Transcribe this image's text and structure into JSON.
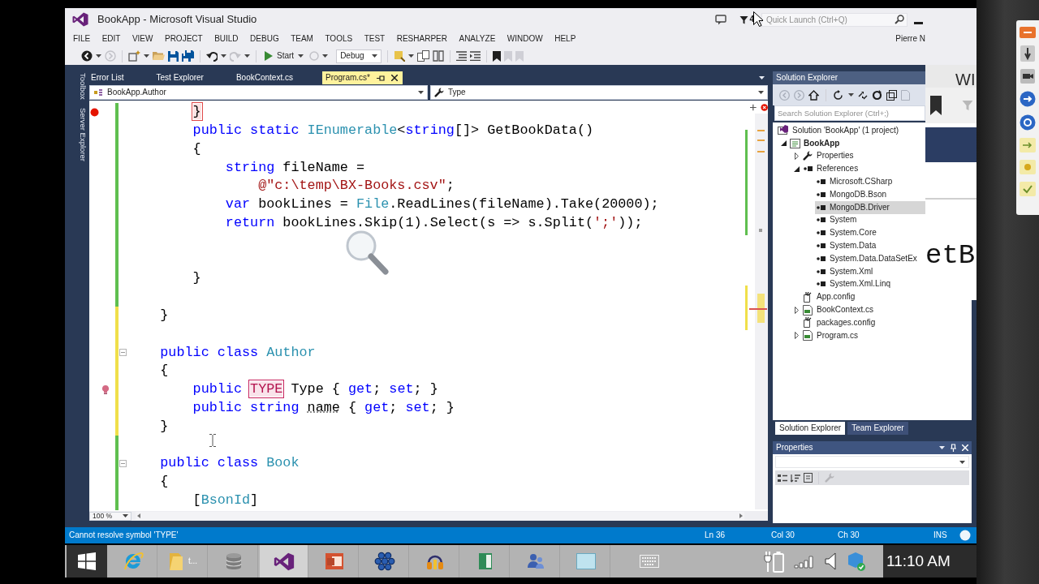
{
  "window": {
    "title": "BookApp - Microsoft Visual Studio",
    "notifications": "4",
    "quick_launch": {
      "placeholder": "Quick Launch (Ctrl+Q)"
    },
    "user": "Pierre N"
  },
  "menu": [
    "FILE",
    "EDIT",
    "VIEW",
    "PROJECT",
    "BUILD",
    "DEBUG",
    "TEAM",
    "TOOLS",
    "TEST",
    "RESHARPER",
    "ANALYZE",
    "WINDOW",
    "HELP"
  ],
  "toolbar": {
    "start": "Start",
    "configuration": "Debug"
  },
  "side_tabs": [
    "Toolbox",
    "Server Explorer"
  ],
  "document_tabs": [
    {
      "label": "Error List",
      "selected": false
    },
    {
      "label": "Test Explorer",
      "selected": false
    },
    {
      "label": "BookContext.cs",
      "selected": false
    },
    {
      "label": "Program.cs*",
      "selected": true
    }
  ],
  "navigation_bar": {
    "type": "BookApp.Author",
    "member": "Type"
  },
  "editor": {
    "zoom": "100 %",
    "lines": [
      {
        "kind": "code",
        "unsaved": false,
        "breakpoint": true,
        "segments": [
          {
            "kind": "brace",
            "text": "        }"
          }
        ]
      },
      {
        "kind": "code",
        "unsaved": false,
        "segments": [
          {
            "kind": "keyword",
            "text": "        public static "
          },
          {
            "kind": "type",
            "text": "IEnumerable"
          },
          {
            "kind": "plain",
            "text": "<"
          },
          {
            "kind": "keyword",
            "text": "string"
          },
          {
            "kind": "plain",
            "text": "[]> GetBookData()"
          }
        ]
      },
      {
        "kind": "code",
        "unsaved": false,
        "segments": [
          {
            "kind": "plain",
            "text": "        {"
          }
        ]
      },
      {
        "kind": "code",
        "unsaved": false,
        "segments": [
          {
            "kind": "keyword",
            "text": "            string"
          },
          {
            "kind": "plain",
            "text": " fileName ="
          }
        ]
      },
      {
        "kind": "code",
        "unsaved": false,
        "segments": [
          {
            "kind": "string",
            "text": "                @\"c:\\temp\\BX-Books.csv\""
          },
          {
            "kind": "plain",
            "text": ";"
          }
        ]
      },
      {
        "kind": "code",
        "unsaved": false,
        "segments": [
          {
            "kind": "keyword",
            "text": "            var"
          },
          {
            "kind": "plain",
            "text": " bookLines = "
          },
          {
            "kind": "type",
            "text": "File"
          },
          {
            "kind": "plain",
            "text": ".ReadLines(fileName).Take(20000);"
          }
        ]
      },
      {
        "kind": "code",
        "unsaved": false,
        "segments": [
          {
            "kind": "keyword",
            "text": "            return"
          },
          {
            "kind": "plain",
            "text": " bookLines.Skip(1).Select(s => s.Split("
          },
          {
            "kind": "string",
            "text": "';'"
          },
          {
            "kind": "plain",
            "text": "));"
          }
        ]
      },
      {
        "kind": "blank",
        "unsaved": false
      },
      {
        "kind": "blank",
        "unsaved": false
      },
      {
        "kind": "code",
        "unsaved": false,
        "segments": [
          {
            "kind": "plain",
            "text": "        }"
          }
        ]
      },
      {
        "kind": "blank",
        "unsaved": false
      },
      {
        "kind": "code",
        "unsaved": true,
        "segments": [
          {
            "kind": "plain",
            "text": "    }"
          }
        ]
      },
      {
        "kind": "blank",
        "unsaved": true
      },
      {
        "kind": "code",
        "unsaved": true,
        "expanded": true,
        "segments": [
          {
            "kind": "keyword",
            "text": "    public class "
          },
          {
            "kind": "type",
            "text": "Author"
          }
        ]
      },
      {
        "kind": "code",
        "unsaved": true,
        "segments": [
          {
            "kind": "plain",
            "text": "    {"
          }
        ]
      },
      {
        "kind": "code",
        "unsaved": true,
        "quick_fix": true,
        "segments": [
          {
            "kind": "keyword",
            "text": "        public "
          },
          {
            "kind": "error",
            "text": "TYPE"
          },
          {
            "kind": "plain",
            "text": " Type { "
          },
          {
            "kind": "keyword",
            "text": "get"
          },
          {
            "kind": "plain",
            "text": "; "
          },
          {
            "kind": "keyword",
            "text": "set"
          },
          {
            "kind": "plain",
            "text": "; }"
          }
        ]
      },
      {
        "kind": "code",
        "unsaved": true,
        "segments": [
          {
            "kind": "keyword",
            "text": "        public string "
          },
          {
            "kind": "hint",
            "text": "name"
          },
          {
            "kind": "plain",
            "text": " { "
          },
          {
            "kind": "keyword",
            "text": "get"
          },
          {
            "kind": "plain",
            "text": "; "
          },
          {
            "kind": "keyword",
            "text": "set"
          },
          {
            "kind": "plain",
            "text": "; }"
          }
        ]
      },
      {
        "kind": "code",
        "unsaved": true,
        "segments": [
          {
            "kind": "plain",
            "text": "    }"
          }
        ]
      },
      {
        "kind": "blank",
        "unsaved": false
      },
      {
        "kind": "code",
        "unsaved": false,
        "expanded": true,
        "segments": [
          {
            "kind": "keyword",
            "text": "    public class "
          },
          {
            "kind": "type",
            "text": "Book"
          }
        ]
      },
      {
        "kind": "code",
        "unsaved": false,
        "segments": [
          {
            "kind": "plain",
            "text": "    {"
          }
        ]
      },
      {
        "kind": "code",
        "unsaved": false,
        "segments": [
          {
            "kind": "plain",
            "text": "        ["
          },
          {
            "kind": "type",
            "text": "BsonId"
          },
          {
            "kind": "plain",
            "text": "]"
          }
        ]
      }
    ]
  },
  "solution_explorer": {
    "title": "Solution Explorer",
    "search": {
      "placeholder": "Search Solution Explorer (Ctrl+;)"
    },
    "tree": [
      {
        "label": "Solution 'BookApp' (1 project)",
        "kind": "solution",
        "selected": false,
        "children": [
          {
            "label": "BookApp",
            "kind": "project",
            "selected": false,
            "expanded": true,
            "children": [
              {
                "label": "Properties",
                "kind": "properties",
                "selected": false,
                "expanded": false
              },
              {
                "label": "References",
                "kind": "references",
                "selected": false,
                "expanded": true,
                "children": [
                  {
                    "label": "Microsoft.CSharp",
                    "kind": "reference",
                    "selected": false
                  },
                  {
                    "label": "MongoDB.Bson",
                    "kind": "reference",
                    "selected": false
                  },
                  {
                    "label": "MongoDB.Driver",
                    "kind": "reference",
                    "selected": true
                  },
                  {
                    "label": "System",
                    "kind": "reference",
                    "selected": false
                  },
                  {
                    "label": "System.Core",
                    "kind": "reference",
                    "selected": false
                  },
                  {
                    "label": "System.Data",
                    "kind": "reference",
                    "selected": false
                  },
                  {
                    "label": "System.Data.DataSetEx",
                    "kind": "reference",
                    "selected": false
                  },
                  {
                    "label": "System.Xml",
                    "kind": "reference",
                    "selected": false
                  },
                  {
                    "label": "System.Xml.Linq",
                    "kind": "reference",
                    "selected": false
                  }
                ]
              },
              {
                "label": "App.config",
                "kind": "config",
                "selected": false
              },
              {
                "label": "BookContext.cs",
                "kind": "code",
                "selected": false,
                "expanded": false
              },
              {
                "label": "packages.config",
                "kind": "config",
                "selected": false
              },
              {
                "label": "Program.cs",
                "kind": "code",
                "selected": false,
                "expanded": false
              }
            ]
          }
        ]
      }
    ],
    "tabs": [
      {
        "label": "Solution Explorer",
        "selected": true
      },
      {
        "label": "Team Explorer",
        "selected": false
      }
    ]
  },
  "properties": {
    "title": "Properties"
  },
  "status_bar": {
    "message": "Cannot resolve symbol 'TYPE'",
    "line": "Ln 36",
    "column": "Col 30",
    "character": "Ch 30",
    "mode": "INS"
  },
  "background_window": {
    "heading": "WI",
    "text": "etB"
  },
  "taskbar": {
    "apps": [
      {
        "kind": "browser",
        "selected": false
      },
      {
        "kind": "folder",
        "label": "t...",
        "selected": false
      },
      {
        "kind": "database",
        "selected": false
      },
      {
        "kind": "ide",
        "selected": true
      },
      {
        "kind": "slides",
        "selected": false
      },
      {
        "kind": "cluster",
        "selected": false
      },
      {
        "kind": "audio",
        "selected": false
      },
      {
        "kind": "book",
        "selected": false
      },
      {
        "kind": "people",
        "selected": false
      },
      {
        "kind": "screen",
        "selected": false
      }
    ],
    "clock": "11:10 AM"
  }
}
